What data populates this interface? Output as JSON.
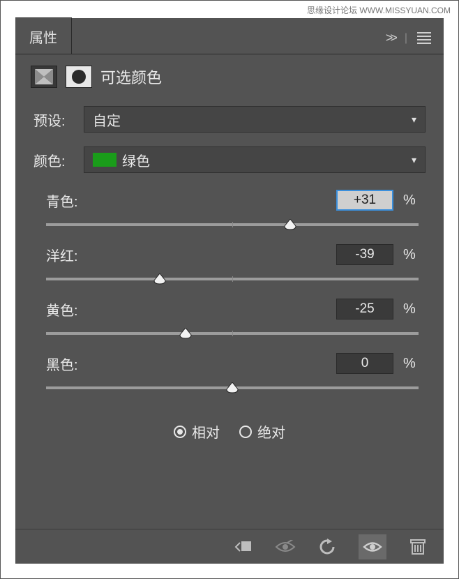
{
  "watermark": "思缘设计论坛  WWW.MISSYUAN.COM",
  "panel": {
    "tab": "属性",
    "title": "可选颜色"
  },
  "fields": {
    "preset_label": "预设:",
    "preset_value": "自定",
    "color_label": "颜色:",
    "color_value": "绿色",
    "color_hex": "#1a9c1a"
  },
  "sliders": [
    {
      "label": "青色:",
      "value": "+31",
      "pos": 65.5,
      "selected": true
    },
    {
      "label": "洋红:",
      "value": "-39",
      "pos": 30.5,
      "selected": false
    },
    {
      "label": "黄色:",
      "value": "-25",
      "pos": 37.5,
      "selected": false
    },
    {
      "label": "黑色:",
      "value": "0",
      "pos": 50,
      "selected": false
    }
  ],
  "mode": {
    "relative": "相对",
    "absolute": "绝对",
    "selected": "relative"
  },
  "percent_sign": "%"
}
